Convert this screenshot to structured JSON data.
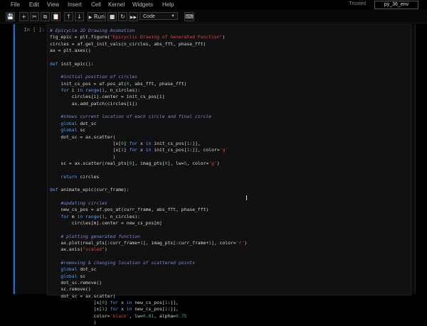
{
  "menu": {
    "items": [
      "File",
      "Edit",
      "View",
      "Insert",
      "Cell",
      "Kernel",
      "Widgets",
      "Help"
    ],
    "trusted": "Trusted",
    "kernel": "py_36_env"
  },
  "toolbar": {
    "save_icon": "save-icon",
    "add_icon": "plus-icon",
    "cut_icon": "scissors-icon",
    "copy_icon": "copy-icon",
    "paste_icon": "paste-icon",
    "up_icon": "arrow-up-icon",
    "down_icon": "arrow-down-icon",
    "run_label": "Run",
    "stop_icon": "stop-icon",
    "restart_icon": "restart-icon",
    "restart_run_icon": "fast-forward-icon",
    "cell_type": "Code",
    "keyboard_icon": "keyboard-icon"
  },
  "cell": {
    "prompt": "In [ ]:",
    "lines": [
      [
        [
          "c",
          "# Epicycle 2D Drawing Animation"
        ]
      ],
      [
        [
          "t",
          "fig_epic = plt.figure("
        ],
        [
          "s",
          "\"Epicyclic Drawing of Generated Function\""
        ],
        [
          "t",
          ")"
        ]
      ],
      [
        [
          "t",
          "circles = af.get_init_vals(n_circles, abs_fft, phase_fft)"
        ]
      ],
      [
        [
          "t",
          "ax = plt.axes()"
        ]
      ],
      [],
      [
        [
          "k",
          "def"
        ],
        [
          "t",
          " init_epic():"
        ]
      ],
      [],
      [
        [
          "t",
          "    "
        ],
        [
          "c",
          "#initial position of circles"
        ]
      ],
      [
        [
          "t",
          "    init_cs_pos = af.pos_at("
        ],
        [
          "n",
          "0"
        ],
        [
          "t",
          ", abs_fft, phase_fft)"
        ]
      ],
      [
        [
          "t",
          "    "
        ],
        [
          "k",
          "for"
        ],
        [
          "t",
          " i "
        ],
        [
          "k",
          "in"
        ],
        [
          "t",
          " "
        ],
        [
          "k",
          "range"
        ],
        [
          "t",
          "("
        ],
        [
          "n",
          "1"
        ],
        [
          "t",
          ", n_circles):"
        ]
      ],
      [
        [
          "t",
          "        circles[i].center = init_cs_pos[i]"
        ]
      ],
      [
        [
          "t",
          "        ax.add_patch(circles[i])"
        ]
      ],
      [],
      [
        [
          "t",
          "    "
        ],
        [
          "c",
          "#shows current location of each circle and final circle"
        ]
      ],
      [
        [
          "t",
          "    "
        ],
        [
          "k",
          "global"
        ],
        [
          "t",
          " dot_sc"
        ]
      ],
      [
        [
          "t",
          "    "
        ],
        [
          "k",
          "global"
        ],
        [
          "t",
          " sc"
        ]
      ],
      [
        [
          "t",
          "    dot_sc = ax.scatter("
        ]
      ],
      [
        [
          "t",
          "                       [x["
        ],
        [
          "n",
          "0"
        ],
        [
          "t",
          "] "
        ],
        [
          "k",
          "for"
        ],
        [
          "t",
          " x "
        ],
        [
          "k",
          "in"
        ],
        [
          "t",
          " init_cs_pos["
        ],
        [
          "n",
          "1"
        ],
        [
          "t",
          ":]],"
        ]
      ],
      [
        [
          "t",
          "                       [x["
        ],
        [
          "n",
          "1"
        ],
        [
          "t",
          "] "
        ],
        [
          "k",
          "for"
        ],
        [
          "t",
          " x "
        ],
        [
          "k",
          "in"
        ],
        [
          "t",
          " init_cs_pos["
        ],
        [
          "n",
          "1"
        ],
        [
          "t",
          ":]], color="
        ],
        [
          "s",
          "'g'"
        ]
      ],
      [
        [
          "t",
          "                       )"
        ]
      ],
      [
        [
          "t",
          "    sc = ax.scatter(real_pts["
        ],
        [
          "n",
          "0"
        ],
        [
          "t",
          "], imag_pts["
        ],
        [
          "n",
          "0"
        ],
        [
          "t",
          "], lw="
        ],
        [
          "n",
          "5"
        ],
        [
          "t",
          ", color="
        ],
        [
          "s",
          "'g'"
        ],
        [
          "t",
          ")"
        ]
      ],
      [],
      [
        [
          "t",
          "    "
        ],
        [
          "k",
          "return"
        ],
        [
          "t",
          " circles"
        ]
      ],
      [],
      [
        [
          "k",
          "def"
        ],
        [
          "t",
          " animate_epic(curr_frame):"
        ]
      ],
      [],
      [
        [
          "t",
          "    "
        ],
        [
          "c",
          "#updating circles"
        ]
      ],
      [
        [
          "t",
          "    new_cs_pos = af.pos_at(curr_frame, abs_fft, phase_fft)"
        ]
      ],
      [
        [
          "t",
          "    "
        ],
        [
          "k",
          "for"
        ],
        [
          "t",
          " m "
        ],
        [
          "k",
          "in"
        ],
        [
          "t",
          " "
        ],
        [
          "k",
          "range"
        ],
        [
          "t",
          "("
        ],
        [
          "n",
          "1"
        ],
        [
          "t",
          ", n_circles):"
        ]
      ],
      [
        [
          "t",
          "        circles[m].center = new_cs_pos[m]"
        ]
      ],
      [],
      [
        [
          "t",
          "    "
        ],
        [
          "c",
          "# plotting generated function"
        ]
      ],
      [
        [
          "t",
          "    ax.plot(real_pts[:curr_frame+"
        ],
        [
          "n",
          "1"
        ],
        [
          "t",
          "], imag_pts[:curr_frame+"
        ],
        [
          "n",
          "1"
        ],
        [
          "t",
          "], color="
        ],
        [
          "s",
          "'r'"
        ],
        [
          "t",
          ")"
        ]
      ],
      [
        [
          "t",
          "    ax.axis("
        ],
        [
          "s",
          "\"scaled\""
        ],
        [
          "t",
          ")"
        ]
      ],
      [],
      [
        [
          "t",
          "    "
        ],
        [
          "c",
          "#removing & changing location of scattered points"
        ]
      ],
      [
        [
          "t",
          "    "
        ],
        [
          "k",
          "global"
        ],
        [
          "t",
          " dot_sc"
        ]
      ],
      [
        [
          "t",
          "    "
        ],
        [
          "k",
          "global"
        ],
        [
          "t",
          " sc"
        ]
      ],
      [
        [
          "t",
          "    dot_sc.remove()"
        ]
      ],
      [
        [
          "t",
          "    sc.remove()"
        ]
      ],
      [
        [
          "t",
          "    dot_sc = ax.scatter("
        ]
      ],
      [
        [
          "t",
          "                [x["
        ],
        [
          "n",
          "0"
        ],
        [
          "t",
          "] "
        ],
        [
          "k",
          "for"
        ],
        [
          "t",
          " x "
        ],
        [
          "k",
          "in"
        ],
        [
          "t",
          " new_cs_pos["
        ],
        [
          "n",
          "1"
        ],
        [
          "t",
          ":]],"
        ]
      ],
      [
        [
          "t",
          "                [x["
        ],
        [
          "n",
          "1"
        ],
        [
          "t",
          "] "
        ],
        [
          "k",
          "for"
        ],
        [
          "t",
          " x "
        ],
        [
          "k",
          "in"
        ],
        [
          "t",
          " new_cs_pos["
        ],
        [
          "n",
          "1"
        ],
        [
          "t",
          ":]],"
        ]
      ],
      [
        [
          "t",
          "                color="
        ],
        [
          "s",
          "'black'"
        ],
        [
          "t",
          ", lw="
        ],
        [
          "n",
          "0.01"
        ],
        [
          "t",
          ", alpha="
        ],
        [
          "n",
          "0.75"
        ]
      ],
      [
        [
          "t",
          "                )"
        ]
      ]
    ]
  }
}
